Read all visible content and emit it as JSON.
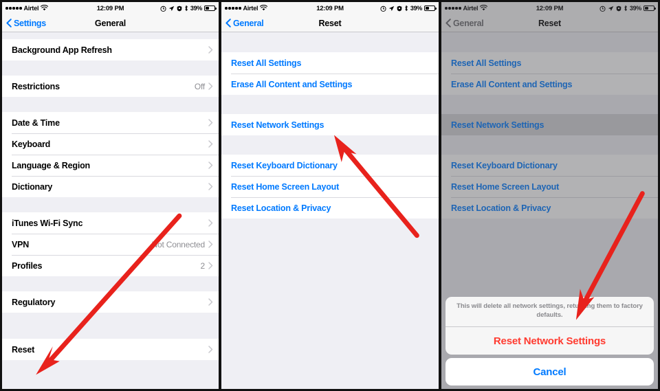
{
  "statusbar": {
    "carrier": "Airtel",
    "signal_dots": 5,
    "time": "12:09 PM",
    "battery_percent": "39%",
    "icons": [
      "alarm-icon",
      "location-arrow-icon",
      "rotation-lock-icon",
      "bluetooth-icon"
    ]
  },
  "colors": {
    "ios_blue": "#007aff",
    "destructive_red": "#ff3b30",
    "arrow_red": "#e8221c",
    "list_bg": "#efeff4",
    "separator": "#d9d9de"
  },
  "panels": [
    {
      "id": "general-settings",
      "nav": {
        "back_label": "Settings",
        "title": "General"
      },
      "groups": [
        {
          "rows": [
            {
              "label": "Background App Refresh",
              "value": "",
              "chevron": true
            }
          ]
        },
        {
          "rows": [
            {
              "label": "Restrictions",
              "value": "Off",
              "chevron": true
            }
          ]
        },
        {
          "rows": [
            {
              "label": "Date & Time",
              "value": "",
              "chevron": true
            },
            {
              "label": "Keyboard",
              "value": "",
              "chevron": true
            },
            {
              "label": "Language & Region",
              "value": "",
              "chevron": true
            },
            {
              "label": "Dictionary",
              "value": "",
              "chevron": true
            }
          ]
        },
        {
          "rows": [
            {
              "label": "iTunes Wi-Fi Sync",
              "value": "",
              "chevron": true
            },
            {
              "label": "VPN",
              "value": "Not Connected",
              "chevron": true
            },
            {
              "label": "Profiles",
              "value": "2",
              "chevron": true
            }
          ]
        },
        {
          "rows": [
            {
              "label": "Regulatory",
              "value": "",
              "chevron": true
            }
          ]
        },
        {
          "rows": [
            {
              "label": "Reset",
              "value": "",
              "chevron": true
            }
          ]
        }
      ]
    },
    {
      "id": "reset-menu",
      "nav": {
        "back_label": "General",
        "title": "Reset"
      },
      "groups": [
        {
          "rows": [
            {
              "label": "Reset All Settings",
              "link": true
            },
            {
              "label": "Erase All Content and Settings",
              "link": true
            }
          ]
        },
        {
          "rows": [
            {
              "label": "Reset Network Settings",
              "link": true
            }
          ]
        },
        {
          "rows": [
            {
              "label": "Reset Keyboard Dictionary",
              "link": true
            },
            {
              "label": "Reset Home Screen Layout",
              "link": true
            },
            {
              "label": "Reset Location & Privacy",
              "link": true
            }
          ]
        }
      ]
    },
    {
      "id": "reset-confirm",
      "nav": {
        "back_label": "General",
        "title": "Reset"
      },
      "dimmed": true,
      "groups": [
        {
          "rows": [
            {
              "label": "Reset All Settings",
              "link": true
            },
            {
              "label": "Erase All Content and Settings",
              "link": true
            }
          ]
        },
        {
          "rows": [
            {
              "label": "Reset Network Settings",
              "link": true,
              "highlight": true
            }
          ]
        },
        {
          "rows": [
            {
              "label": "Reset Keyboard Dictionary",
              "link": true
            },
            {
              "label": "Reset Home Screen Layout",
              "link": true
            },
            {
              "label": "Reset Location & Privacy",
              "link": true
            }
          ]
        }
      ],
      "action_sheet": {
        "message": "This will delete all network settings, returning them to factory defaults.",
        "destructive_label": "Reset Network Settings",
        "cancel_label": "Cancel"
      }
    }
  ],
  "annotations": [
    {
      "name": "arrow-to-reset",
      "panel": 1,
      "points_at": "Reset"
    },
    {
      "name": "arrow-to-reset-network-settings",
      "panel": 2,
      "points_at": "Reset Network Settings"
    },
    {
      "name": "arrow-to-confirm-reset-network-settings",
      "panel": 3,
      "points_at": "Reset Network Settings"
    }
  ]
}
